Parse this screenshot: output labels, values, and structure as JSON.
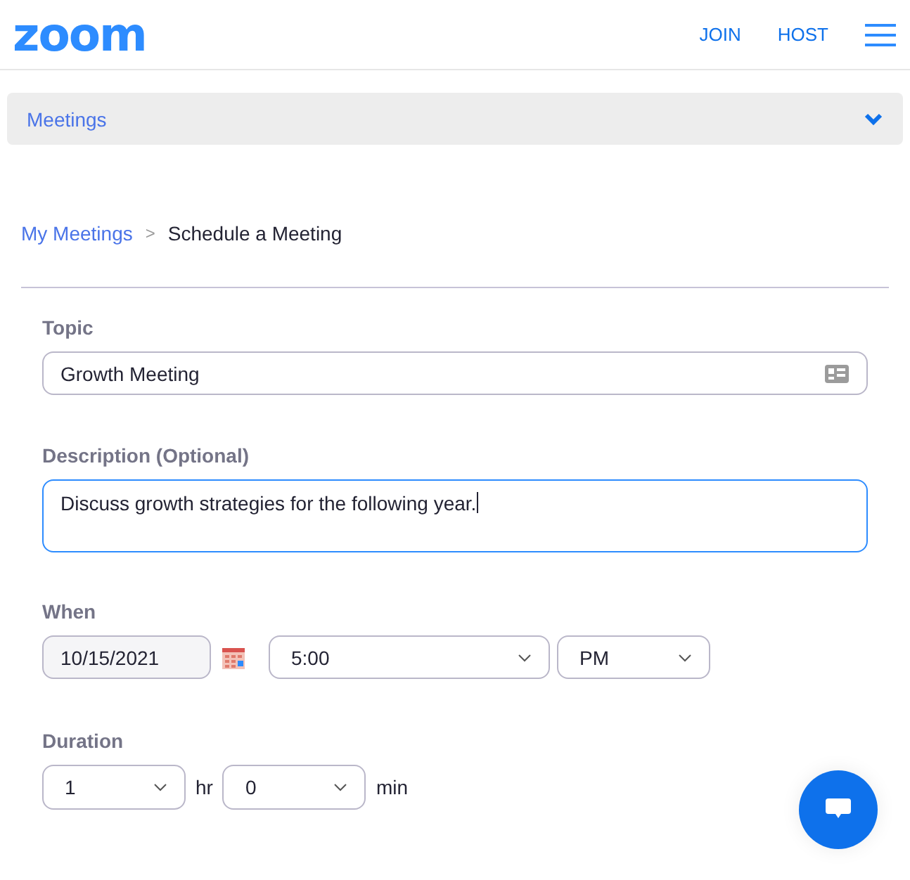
{
  "header": {
    "logo": "zoom",
    "links": [
      "JOIN",
      "HOST"
    ]
  },
  "section_bar": {
    "label": "Meetings",
    "expanded": false
  },
  "breadcrumb": {
    "link": "My Meetings",
    "separator": ">",
    "current": "Schedule a Meeting"
  },
  "form": {
    "topic": {
      "label": "Topic",
      "value": "Growth Meeting"
    },
    "description": {
      "label": "Description (Optional)",
      "value": "Discuss growth strategies for the following year.",
      "focused": true
    },
    "when": {
      "label": "When",
      "date": "10/15/2021",
      "time": "5:00",
      "period": "PM"
    },
    "duration": {
      "label": "Duration",
      "hours": "1",
      "hours_unit": "hr",
      "minutes": "0",
      "minutes_unit": "min"
    }
  }
}
